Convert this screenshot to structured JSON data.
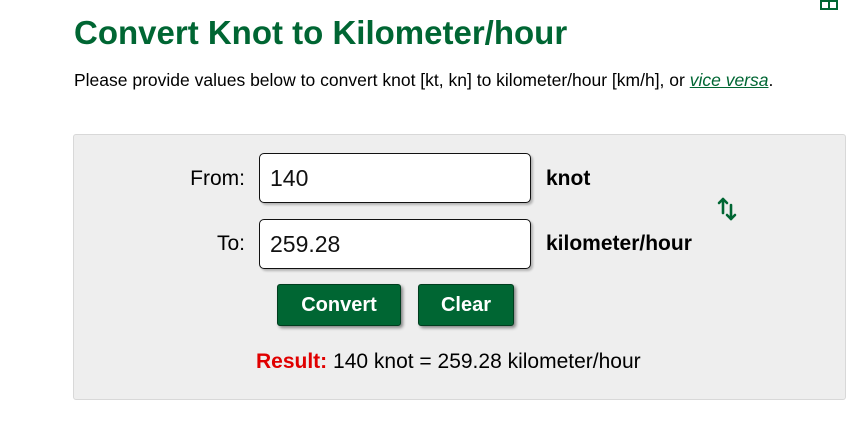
{
  "page": {
    "title": "Convert Knot to Kilometer/hour",
    "intro_text": "Please provide values below to convert knot [kt, kn] to kilometer/hour [km/h], or ",
    "intro_link": "vice versa",
    "intro_end": "."
  },
  "converter": {
    "from_label": "From:",
    "to_label": "To:",
    "from_value": "140",
    "to_value": "259.28",
    "from_unit": "knot",
    "to_unit": "kilometer/hour",
    "convert_label": "Convert",
    "clear_label": "Clear",
    "result_label": "Result:",
    "result_text": " 140 knot = 259.28 kilometer/hour"
  },
  "colors": {
    "brand_green": "#006633",
    "result_red": "#e00000",
    "panel_bg": "#eeeeee"
  },
  "icons": {
    "top_right": "table-icon",
    "swap": "swap-arrows-icon"
  }
}
